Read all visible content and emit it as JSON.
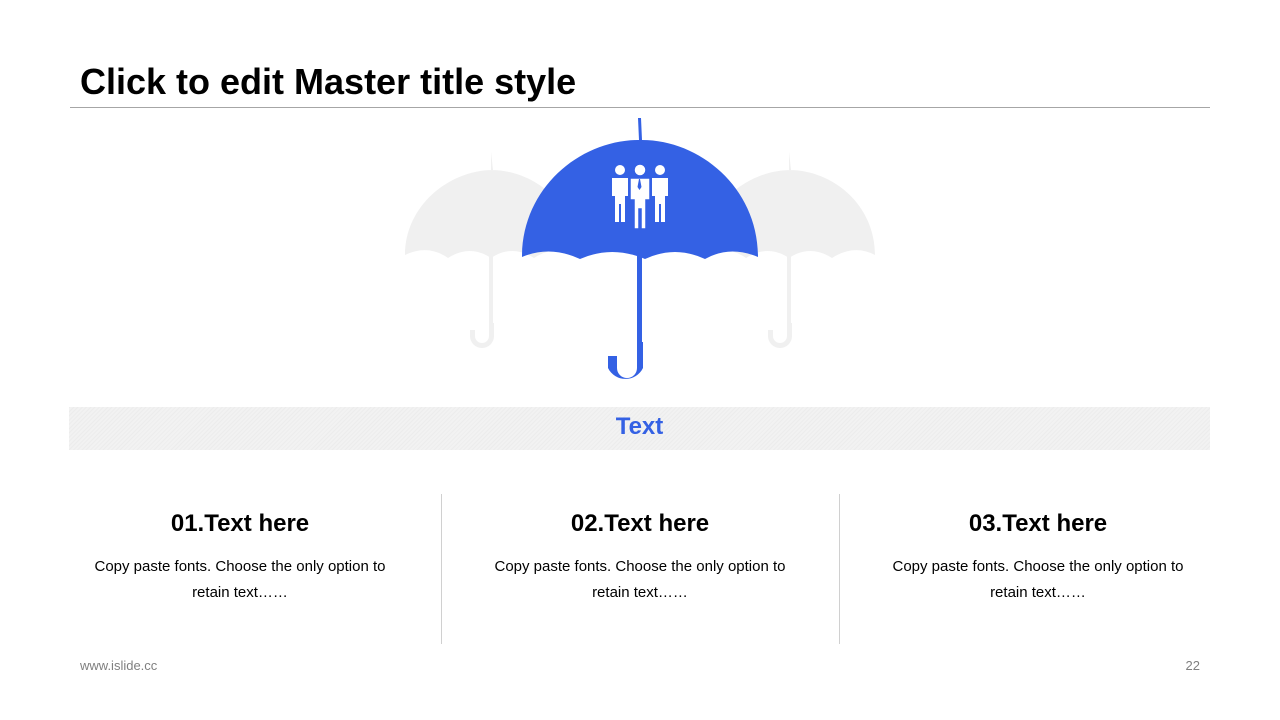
{
  "slide": {
    "title": "Click to edit Master title style",
    "band_label": "Text",
    "columns": [
      {
        "heading": "01.Text here",
        "body": "Copy paste fonts. Choose the only option to retain text……"
      },
      {
        "heading": "02.Text here",
        "body": "Copy paste fonts. Choose the only option to retain text……"
      },
      {
        "heading": "03.Text here",
        "body": "Copy paste fonts. Choose the only option to retain text……"
      }
    ],
    "footer_url": "www.islide.cc",
    "page_number": "22"
  },
  "colors": {
    "accent": "#3461e4",
    "umbrella_faded": "#f0f0f0",
    "text": "#000000",
    "footer": "#7f7f7f"
  },
  "icons": {
    "main": "umbrella-icon",
    "center": "people-group-icon"
  }
}
